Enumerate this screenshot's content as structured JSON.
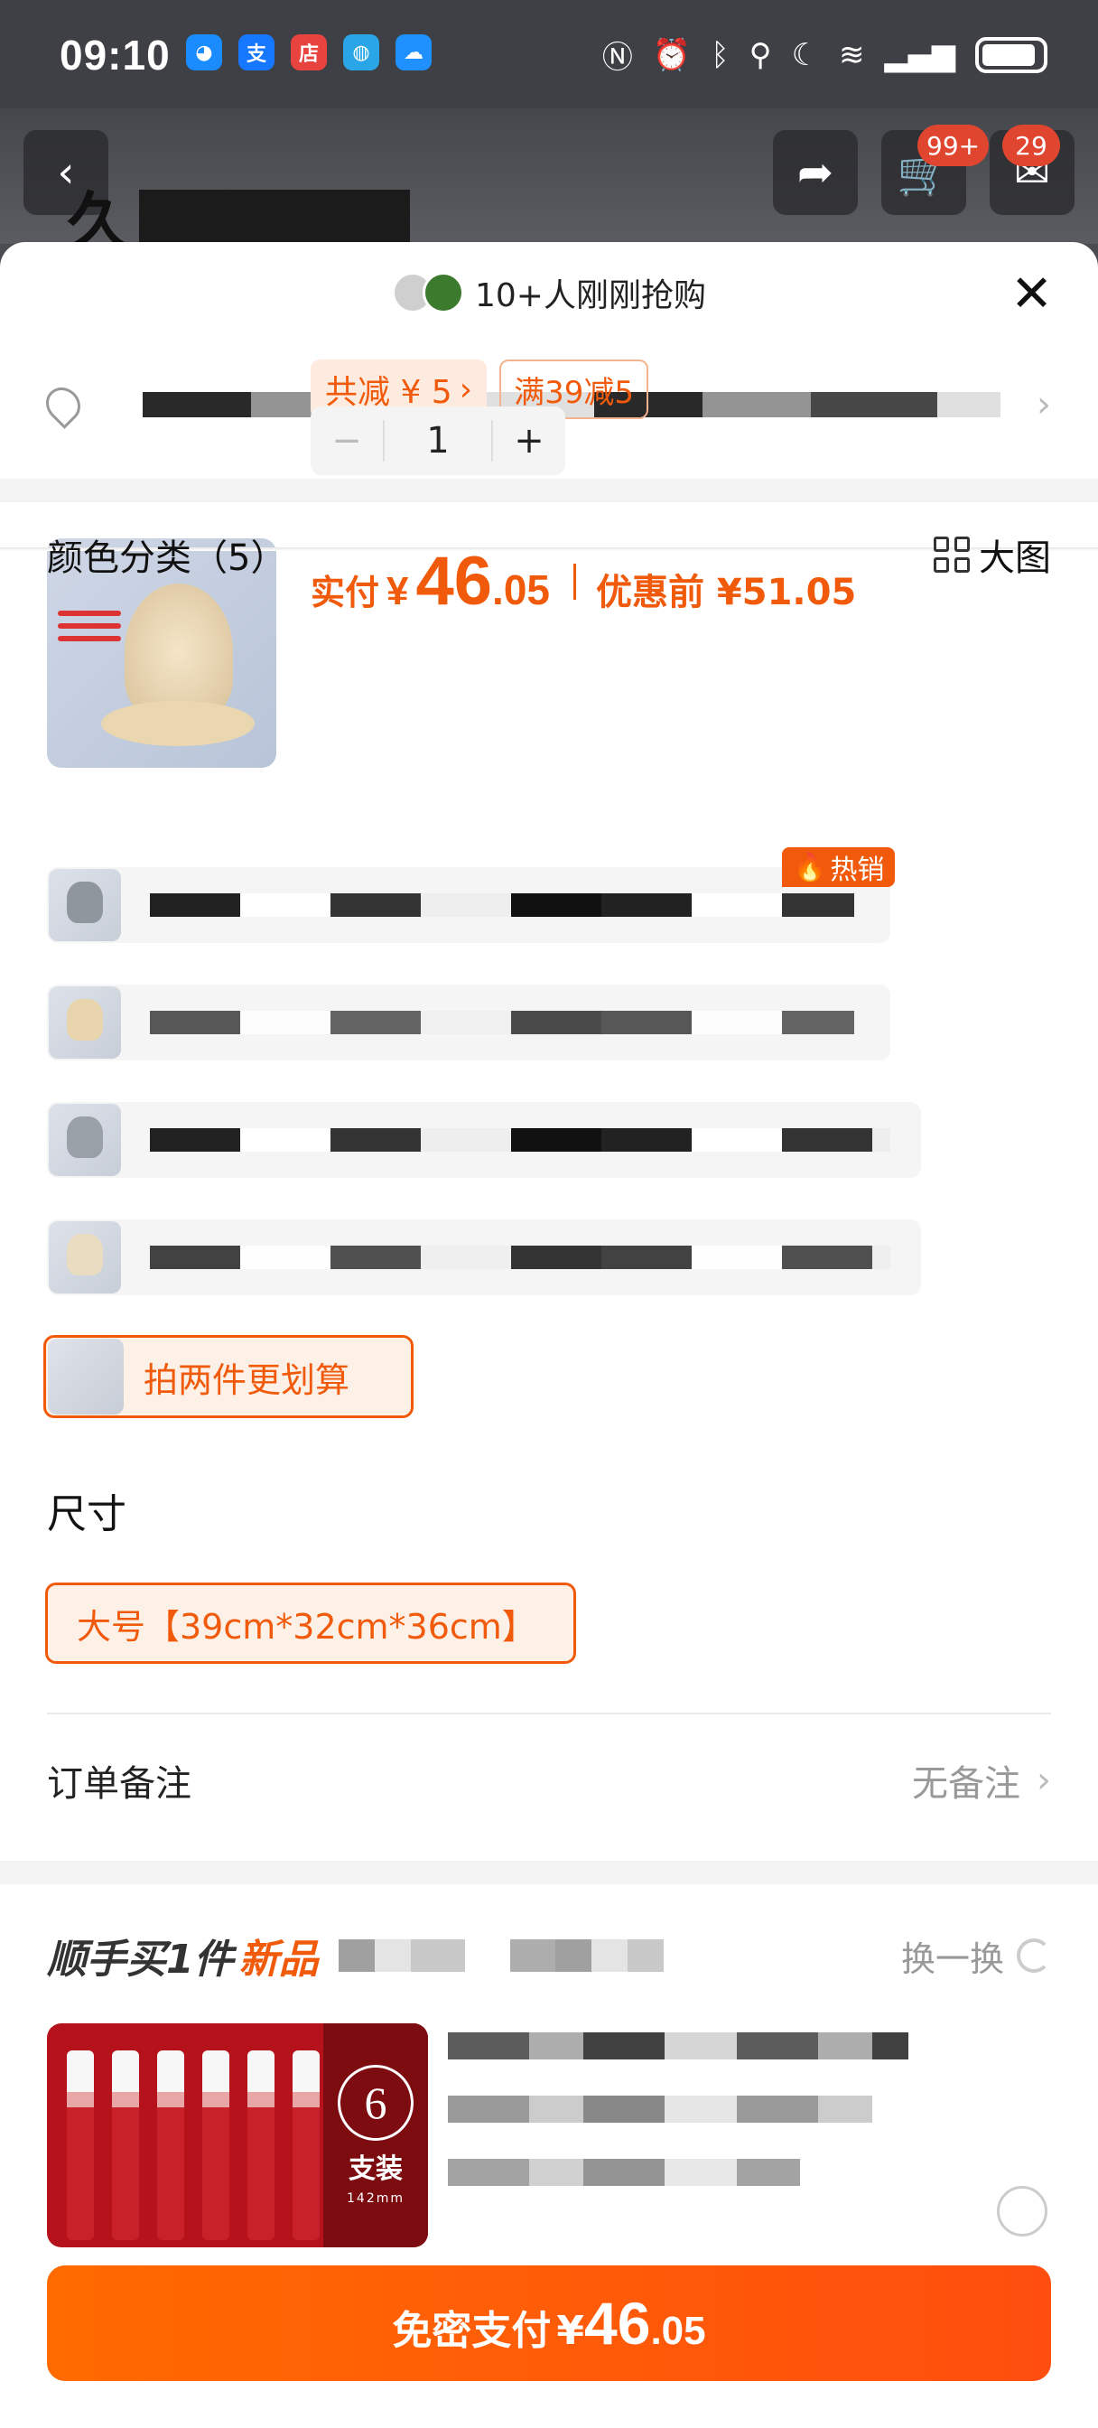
{
  "status_bar": {
    "time": "09:10",
    "apps": [
      {
        "name": "qq-icon",
        "glyph": "◕",
        "color": "#1a8cff"
      },
      {
        "name": "alipay-icon",
        "glyph": "支",
        "color": "#1677ff"
      },
      {
        "name": "live-store-icon",
        "glyph": "店",
        "color": "#e8433f"
      },
      {
        "name": "browser-icon",
        "glyph": "◍",
        "color": "#2aa6e8"
      },
      {
        "name": "weather-icon",
        "glyph": "☁",
        "color": "#1e90ff"
      }
    ]
  },
  "background_page": {
    "cart_badge": "99+",
    "message_badge": "29",
    "title_visible": "久"
  },
  "sheet": {
    "buyers_text": "10+人刚刚抢购",
    "product": {
      "paid_label": "实付",
      "currency": "¥",
      "price_int": "46",
      "price_dec": ".05",
      "before_price": "优惠前 ¥51.05",
      "discount_tag": "共减 ¥ 5",
      "coupon_tag": "满39减5",
      "quantity": "1",
      "minus": "−",
      "plus": "+"
    },
    "color_section": {
      "title": "颜色分类（5）",
      "big_image_label": "大图",
      "hot_label": "热销"
    },
    "bundle_label": "拍两件更划算",
    "size_section": {
      "title": "尺寸",
      "option": "大号【39cm*32cm*36cm】"
    },
    "order_note": {
      "label": "订单备注",
      "value": "无备注"
    },
    "recommend": {
      "title": "顺手买1件",
      "title_new": "新品",
      "swap_label": "换一换",
      "product_count": "6",
      "product_count_unit": "支装",
      "product_length": "142mm"
    },
    "pay_button": {
      "label": "免密支付",
      "currency": "¥",
      "int": "46",
      "dec": ".05"
    }
  },
  "colors": {
    "accent": "#f05a0a",
    "accent_bg": "#fdf0e7"
  }
}
